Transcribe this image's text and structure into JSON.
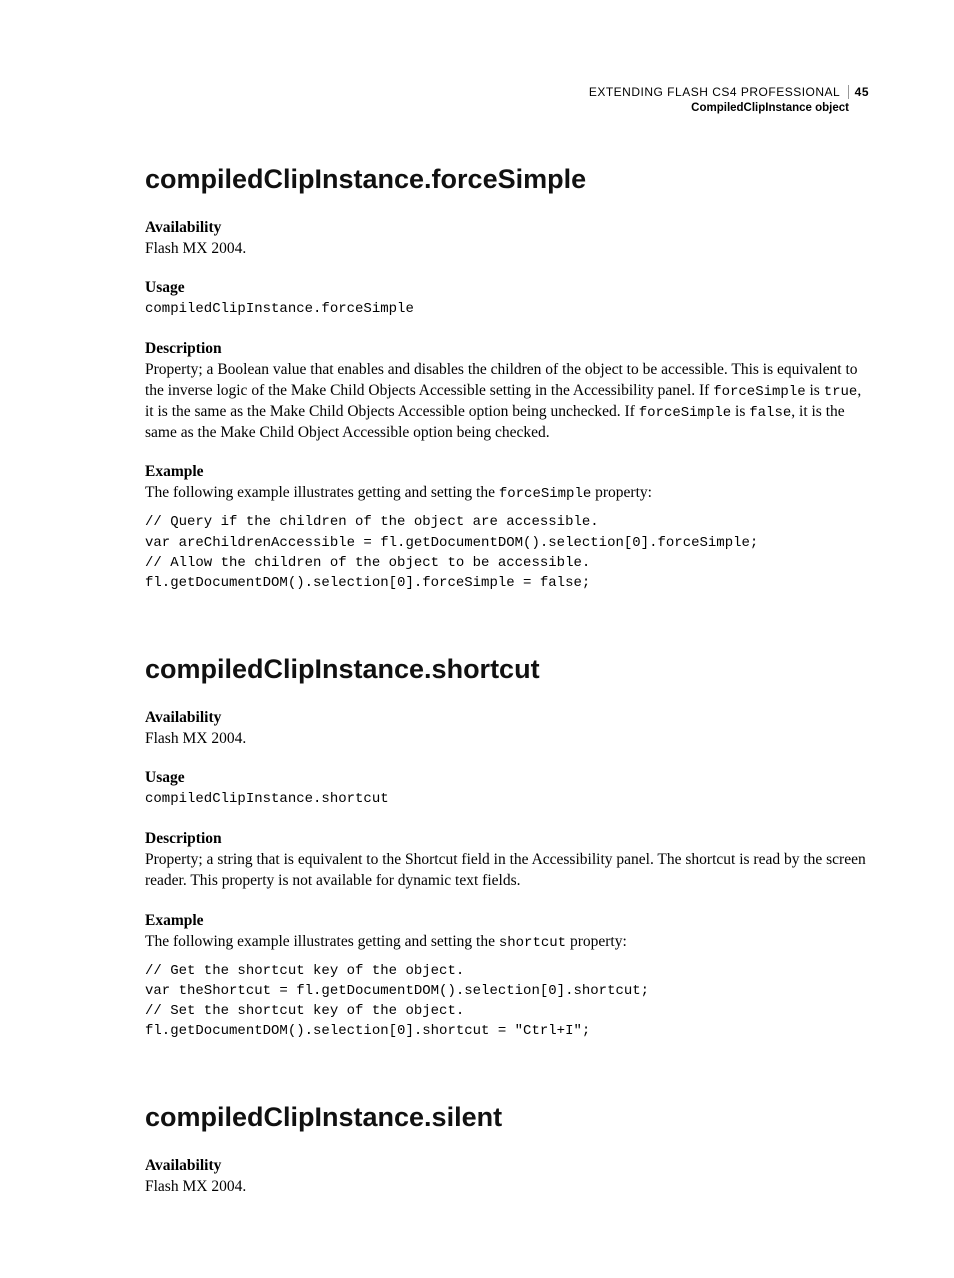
{
  "header": {
    "doc_title": "EXTENDING FLASH CS4 PROFESSIONAL",
    "page_number": "45",
    "section": "CompiledClipInstance object"
  },
  "sections": [
    {
      "title": "compiledClipInstance.forceSimple",
      "availability_label": "Availability",
      "availability_text": "Flash MX 2004.",
      "usage_label": "Usage",
      "usage_code": "compiledClipInstance.forceSimple",
      "description_label": "Description",
      "description_pre": "Property; a Boolean value that enables and disables the children of the object to be accessible. This is equivalent to the inverse logic of the Make Child Objects Accessible setting in the Accessibility panel. If ",
      "description_code1": "forceSimple",
      "description_mid1": " is ",
      "description_code2": "true",
      "description_mid2": ", it is the same as the Make Child Objects Accessible option being unchecked. If ",
      "description_code3": "forceSimple",
      "description_mid3": " is ",
      "description_code4": "false",
      "description_post": ", it is the same as the Make Child Object Accessible option being checked.",
      "example_label": "Example",
      "example_intro_pre": "The following example illustrates getting and setting the ",
      "example_intro_code": "forceSimple",
      "example_intro_post": " property:",
      "example_code": "// Query if the children of the object are accessible. \nvar areChildrenAccessible = fl.getDocumentDOM().selection[0].forceSimple; \n// Allow the children of the object to be accessible. \nfl.getDocumentDOM().selection[0].forceSimple = false;"
    },
    {
      "title": "compiledClipInstance.shortcut",
      "availability_label": "Availability",
      "availability_text": "Flash MX 2004.",
      "usage_label": "Usage",
      "usage_code": "compiledClipInstance.shortcut",
      "description_label": "Description",
      "description_text": "Property; a string that is equivalent to the Shortcut field in the Accessibility panel. The shortcut is read by the screen reader. This property is not available for dynamic text fields.",
      "example_label": "Example",
      "example_intro_pre": "The following example illustrates getting and setting the ",
      "example_intro_code": "shortcut",
      "example_intro_post": " property:",
      "example_code": "// Get the shortcut key of the object. \nvar theShortcut = fl.getDocumentDOM().selection[0].shortcut; \n// Set the shortcut key of the object. \nfl.getDocumentDOM().selection[0].shortcut = \"Ctrl+I\";"
    },
    {
      "title": "compiledClipInstance.silent",
      "availability_label": "Availability",
      "availability_text": "Flash MX 2004."
    }
  ]
}
